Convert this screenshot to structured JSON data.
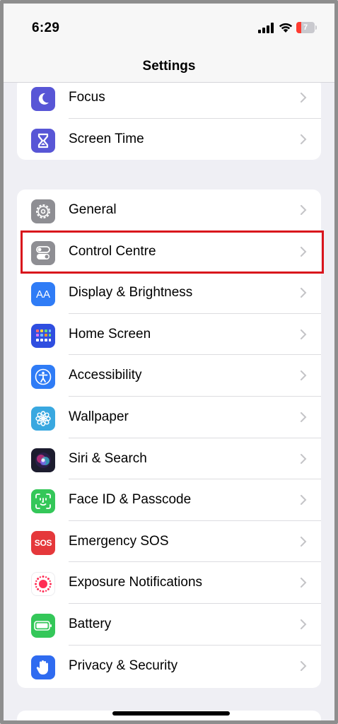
{
  "status_bar": {
    "time": "6:29",
    "battery_level": "7",
    "battery_color": "#ff3b30"
  },
  "nav": {
    "title": "Settings"
  },
  "groups": [
    {
      "items": [
        {
          "label": "Focus",
          "icon": "moon-icon",
          "color": "#5856d6"
        },
        {
          "label": "Screen Time",
          "icon": "hourglass-icon",
          "color": "#5856d6"
        }
      ]
    },
    {
      "items": [
        {
          "label": "General",
          "icon": "gear-icon",
          "color": "#8e8e93"
        },
        {
          "label": "Control Centre",
          "icon": "toggles-icon",
          "color": "#8e8e93"
        },
        {
          "label": "Display & Brightness",
          "icon": "text-size-icon",
          "icon_text": "AA",
          "color": "#2f7cf6"
        },
        {
          "label": "Home Screen",
          "icon": "app-grid-icon",
          "color": "#2f4ee0"
        },
        {
          "label": "Accessibility",
          "icon": "accessibility-icon",
          "color": "#2f7cf6"
        },
        {
          "label": "Wallpaper",
          "icon": "flower-icon",
          "color": "#39a8e0"
        },
        {
          "label": "Siri & Search",
          "icon": "siri-icon",
          "color": "#1c1c2e"
        },
        {
          "label": "Face ID & Passcode",
          "icon": "face-id-icon",
          "color": "#34c759"
        },
        {
          "label": "Emergency SOS",
          "icon": "sos-icon",
          "icon_text": "SOS",
          "color": "#e5383b"
        },
        {
          "label": "Exposure Notifications",
          "icon": "exposure-icon",
          "color": "#ffffff"
        },
        {
          "label": "Battery",
          "icon": "battery-icon",
          "color": "#34c759"
        },
        {
          "label": "Privacy & Security",
          "icon": "hand-icon",
          "color": "#2f6bf0"
        }
      ]
    }
  ],
  "highlight": {
    "target": "Control Centre",
    "color": "#d9141c"
  }
}
